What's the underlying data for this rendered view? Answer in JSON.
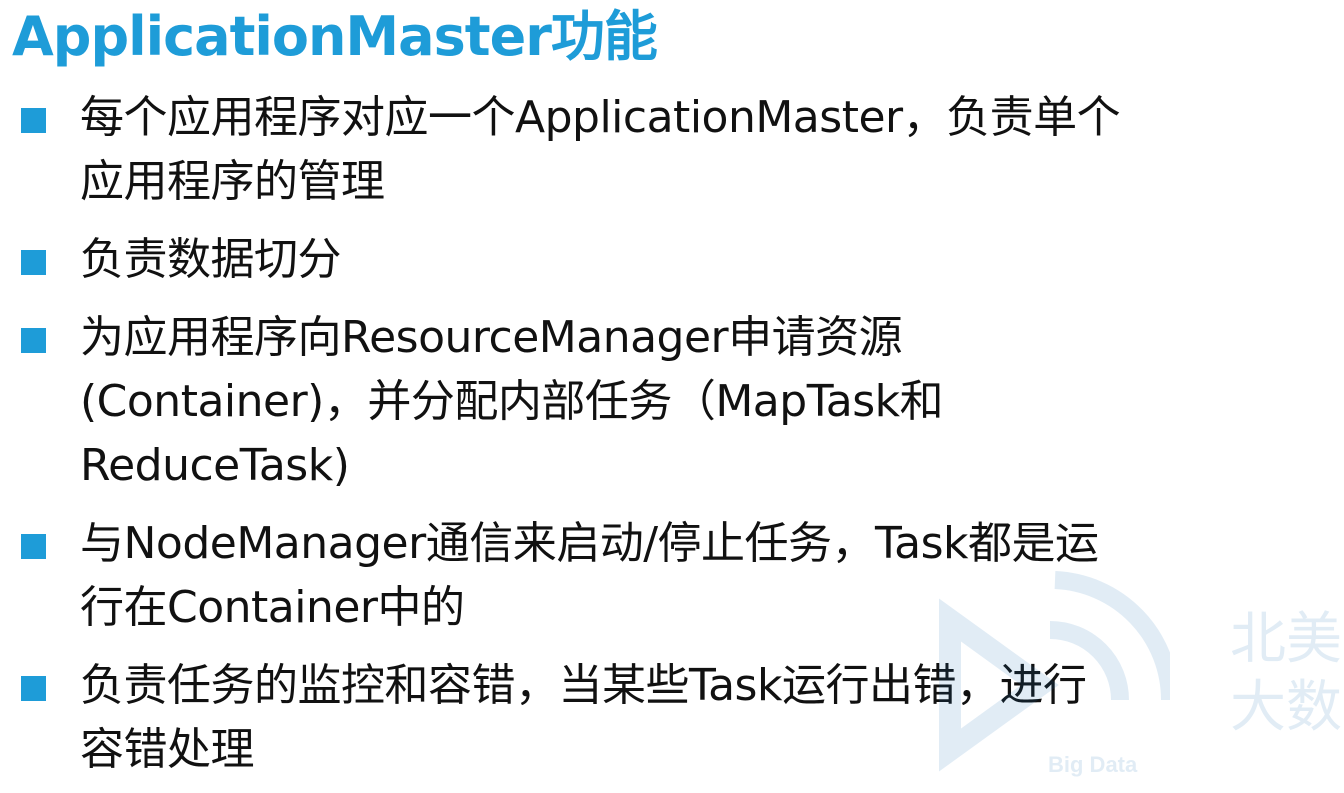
{
  "slide": {
    "title": "ApplicationMaster功能",
    "accent_color": "#1E9CD8",
    "bullets": [
      {
        "text": "每个应用程序对应一个ApplicationMaster，负责单个\n应用程序的管理"
      },
      {
        "text": "负责数据切分"
      },
      {
        "text": "为应用程序向ResourceManager申请资源\n(Container)，并分配内部任务（MapTask和\nReduceTask)"
      },
      {
        "text": "与NodeManager通信来启动/停止任务，Task都是运\n行在Container中的"
      },
      {
        "text": "负责任务的监控和容错，当某些Task运行出错，进行\n容错处理"
      }
    ]
  },
  "watermark": {
    "chars_line1": "北美",
    "chars_line2": "大数",
    "label": "Big Data",
    "icon": "wifi-signal-logo-icon"
  }
}
